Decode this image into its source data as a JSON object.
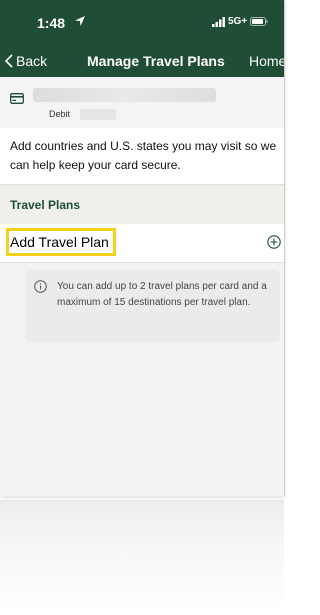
{
  "status_bar": {
    "time": "1:48",
    "network": "5G+"
  },
  "nav": {
    "back_label": "Back",
    "title": "Manage Travel Plans",
    "home_label": "Home"
  },
  "card": {
    "type_label": "Debit"
  },
  "intro_text": "Add countries and U.S. states you may visit so we can help keep your card secure.",
  "section": {
    "title": "Travel Plans"
  },
  "add_plan": {
    "label": "Add Travel Plan"
  },
  "info": {
    "text": "You can add up to 2 travel plans per card and a maximum of 15 destinations per travel plan."
  },
  "colors": {
    "header_bg": "#1f4d35",
    "accent_green": "#1f4d35",
    "highlight_yellow": "#f5d21a"
  },
  "icons": [
    "location-arrow-icon",
    "signal-icon",
    "battery-icon",
    "chevron-left-icon",
    "card-icon",
    "plus-circle-icon",
    "info-icon"
  ]
}
